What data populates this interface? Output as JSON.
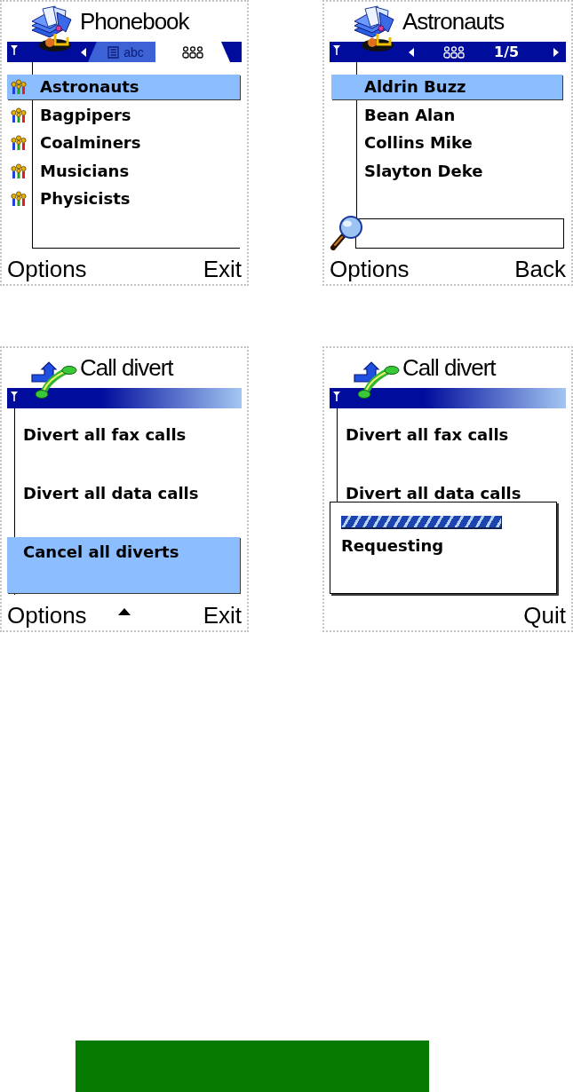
{
  "screens": [
    {
      "kind": "phonebook",
      "title": "Phonebook",
      "nav": {
        "kind": "tabs",
        "tabs": [
          {
            "kind": "names",
            "label": "abc",
            "selected": false
          },
          {
            "kind": "groups",
            "selected": true
          }
        ]
      },
      "list": {
        "kind": "groups",
        "items": [
          {
            "label": "Astronauts",
            "selected": true
          },
          {
            "label": "Bagpipers",
            "selected": false
          },
          {
            "label": "Coalminers",
            "selected": false
          },
          {
            "label": "Musicians",
            "selected": false
          },
          {
            "label": "Physicists",
            "selected": false
          }
        ]
      },
      "softkeys": {
        "left": "Options",
        "right": "Exit"
      }
    },
    {
      "kind": "phonebook",
      "title": "Astronauts",
      "nav": {
        "kind": "pager",
        "page": "1/5"
      },
      "list": {
        "kind": "names",
        "items": [
          {
            "label": "Aldrin Buzz",
            "selected": true
          },
          {
            "label": "Bean Alan",
            "selected": false
          },
          {
            "label": "Collins Mike",
            "selected": false
          },
          {
            "label": "Slayton Deke",
            "selected": false
          }
        ]
      },
      "find_field": true,
      "softkeys": {
        "left": "Options",
        "right": "Back"
      }
    },
    {
      "kind": "call_divert",
      "title": "Call divert",
      "nav": {
        "kind": "plain"
      },
      "list": {
        "kind": "settings",
        "items": [
          {
            "label": "Divert all fax calls",
            "selected": false
          },
          {
            "label": "Divert all data calls",
            "selected": false
          },
          {
            "label": "Cancel all diverts",
            "selected": true
          }
        ]
      },
      "scroll_up": true,
      "softkeys": {
        "left": "Options",
        "right": "Exit"
      }
    },
    {
      "kind": "call_divert",
      "title": "Call divert",
      "nav": {
        "kind": "plain"
      },
      "list": {
        "kind": "settings",
        "items": [
          {
            "label": "Divert all fax calls",
            "selected": false
          },
          {
            "label": "Divert all data calls",
            "selected": false
          }
        ]
      },
      "dialog": {
        "progress": {
          "level": 1
        },
        "text": "Requesting"
      },
      "softkeys": {
        "right": "Quit"
      }
    }
  ]
}
